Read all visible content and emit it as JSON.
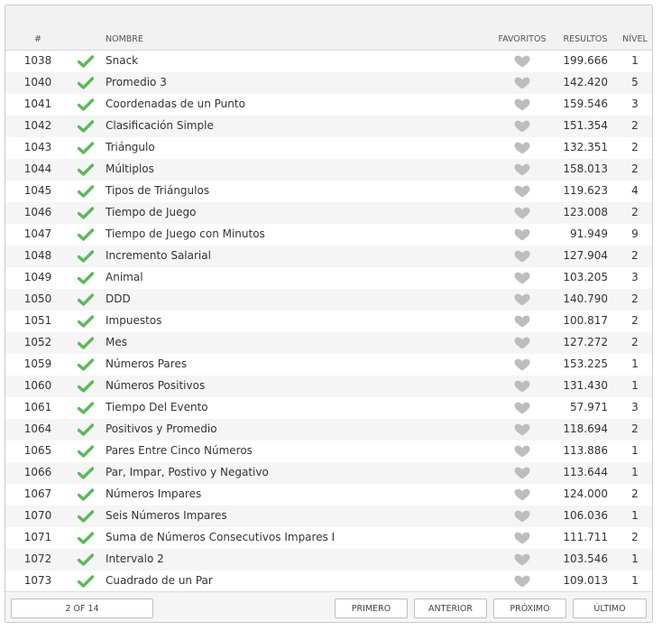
{
  "table": {
    "headers": {
      "id": "#",
      "name": "NOMBRE",
      "favorites": "FAVORITOS",
      "results": "RESULTOS",
      "level": "NÍVEL"
    },
    "rows": [
      {
        "id": "1038",
        "name": "Snack",
        "results": "199.666",
        "level": "1"
      },
      {
        "id": "1040",
        "name": "Promedio 3",
        "results": "142.420",
        "level": "5"
      },
      {
        "id": "1041",
        "name": "Coordenadas de un Punto",
        "results": "159.546",
        "level": "3"
      },
      {
        "id": "1042",
        "name": "Clasificación Simple",
        "results": "151.354",
        "level": "2"
      },
      {
        "id": "1043",
        "name": "Triángulo",
        "results": "132.351",
        "level": "2"
      },
      {
        "id": "1044",
        "name": "Múltiplos",
        "results": "158.013",
        "level": "2"
      },
      {
        "id": "1045",
        "name": "Tipos de Triángulos",
        "results": "119.623",
        "level": "4"
      },
      {
        "id": "1046",
        "name": "Tiempo de Juego",
        "results": "123.008",
        "level": "2"
      },
      {
        "id": "1047",
        "name": "Tiempo de Juego con Minutos",
        "results": "91.949",
        "level": "9"
      },
      {
        "id": "1048",
        "name": "Incremento Salarial",
        "results": "127.904",
        "level": "2"
      },
      {
        "id": "1049",
        "name": "Animal",
        "results": "103.205",
        "level": "3"
      },
      {
        "id": "1050",
        "name": "DDD",
        "results": "140.790",
        "level": "2"
      },
      {
        "id": "1051",
        "name": "Impuestos",
        "results": "100.817",
        "level": "2"
      },
      {
        "id": "1052",
        "name": "Mes",
        "results": "127.272",
        "level": "2"
      },
      {
        "id": "1059",
        "name": "Números Pares",
        "results": "153.225",
        "level": "1"
      },
      {
        "id": "1060",
        "name": "Números Positivos",
        "results": "131.430",
        "level": "1"
      },
      {
        "id": "1061",
        "name": "Tiempo Del Evento",
        "results": "57.971",
        "level": "3"
      },
      {
        "id": "1064",
        "name": "Positivos y Promedio",
        "results": "118.694",
        "level": "2"
      },
      {
        "id": "1065",
        "name": "Pares Entre Cinco Números",
        "results": "113.886",
        "level": "1"
      },
      {
        "id": "1066",
        "name": "Par, Impar, Postivo y Negativo",
        "results": "113.644",
        "level": "1"
      },
      {
        "id": "1067",
        "name": "Números Impares",
        "results": "124.000",
        "level": "2"
      },
      {
        "id": "1070",
        "name": "Seis Números Impares",
        "results": "106.036",
        "level": "1"
      },
      {
        "id": "1071",
        "name": "Suma de Números Consecutivos Impares I",
        "results": "111.711",
        "level": "2"
      },
      {
        "id": "1072",
        "name": "Intervalo 2",
        "results": "103.546",
        "level": "1"
      },
      {
        "id": "1073",
        "name": "Cuadrado de un Par",
        "results": "109.013",
        "level": "1"
      }
    ]
  },
  "icons": {
    "solved": "check-icon",
    "favorite": "heart-icon"
  },
  "colors": {
    "check": "#5cb85c",
    "heart": "#bdbdbd",
    "header_bg": "#f2f2f2",
    "alt_row": "#f5f5f5"
  },
  "pagination": {
    "indicator": "2 OF 14",
    "first": "PRIMERO",
    "previous": "ANTERIOR",
    "next": "PRÓXIMO",
    "last": "ÚLTIMO"
  }
}
